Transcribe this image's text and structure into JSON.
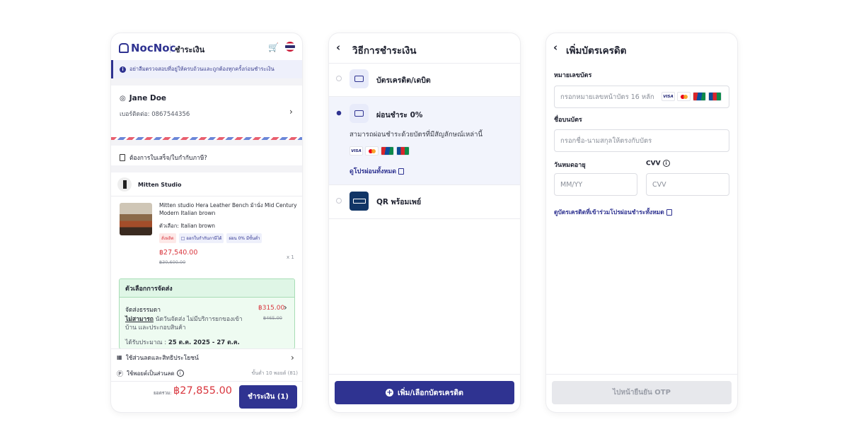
{
  "checkout": {
    "brand": "NocNoc",
    "title": "ชำระเงิน",
    "notice": "อย่าลืมตรวจสอบที่อยู่ให้ครบถ้วนและถูกต้องทุกครั้งก่อนชำระเงิน",
    "address": {
      "name": "Jane Doe",
      "phone_label": "เบอร์ติดต่อ:",
      "phone": "0867544356"
    },
    "tax_invoice": "ต้องการใบเสร็จ/ใบกำกับภาษี?",
    "shop": "Mitten Studio",
    "product": {
      "name": "Mitten studio Hera Leather Bench ม้านั่ง Mid Century Modern Italian brown",
      "option": "ตัวเลือก: Italian brown",
      "tags": [
        "สั่งผลิต",
        "ออกใบกำกับภาษีได้",
        "ผ่อน 0% มีขั้นต่ำ"
      ],
      "price": "฿27,540.00",
      "old_price": "฿30,600.00",
      "qty": "x 1"
    },
    "shipping": {
      "heading": "ตัวเลือกการจัดส่ง",
      "type": "จัดส่งธรรมดา",
      "unable": "ไม่สามารถ",
      "desc": "นัดวันจัดส่ง ไม่มีบริการยกของเข้าบ้าน และประกอบสินค้า",
      "eta_label": "ได้รับประมาณ :",
      "eta": "25 ต.ค. 2025 - 27 ต.ค.",
      "price": "฿315.00",
      "old_price": "฿465.00"
    },
    "discount": "ใช้ส่วนลดและสิทธิประโยชน์",
    "points": "ใช้พอยต์เป็นส่วนลด",
    "points_min": "ขั้นต่ำ 10 พอยต์ (81)",
    "total_label": "ยอดรวม:",
    "total": "฿27,855.00",
    "pay_button": "ชำระเงิน (1)"
  },
  "payment_method": {
    "title": "วิธีการชำระเงิน",
    "options": [
      {
        "label": "บัตรเครดิต/เดบิต",
        "selected": false
      },
      {
        "label": "ผ่อนชำระ 0%",
        "selected": true
      },
      {
        "label": "QR พร้อมเพย์",
        "selected": false
      }
    ],
    "installment_desc": "สามารถผ่อนชำระด้วยบัตรที่มีสัญลักษณ์เหล่านี้",
    "card_brands": [
      "VISA",
      "Mastercard",
      "UnionPay",
      "JCB"
    ],
    "view_promos": "ดูโปรผ่อนทั้งหมด",
    "add_card_button": "เพิ่ม/เลือกบัตรเครดิต"
  },
  "add_card": {
    "title": "เพิ่มบัตรเครดิต",
    "card_number_label": "หมายเลขบัตร",
    "card_number_placeholder": "กรอกหมายเลขหน้าบัตร 16 หลัก",
    "card_name_label": "ชื่อบนบัตร",
    "card_name_placeholder": "กรอกชื่อ-นามสกุลให้ตรงกับบัตร",
    "expiry_label": "วันหมดอายุ",
    "expiry_placeholder": "MM/YY",
    "cvv_label": "CVV",
    "cvv_placeholder": "CVV",
    "promo_link": "ดูบัตรเครดิตที่เข้าร่วมโปรผ่อนชำระทั้งหมด",
    "otp_button": "ไปหน้ายืนยัน OTP"
  },
  "colors": {
    "brand": "#2f3391",
    "price": "#d9363e",
    "shipping_bg": "#eefbf1"
  }
}
